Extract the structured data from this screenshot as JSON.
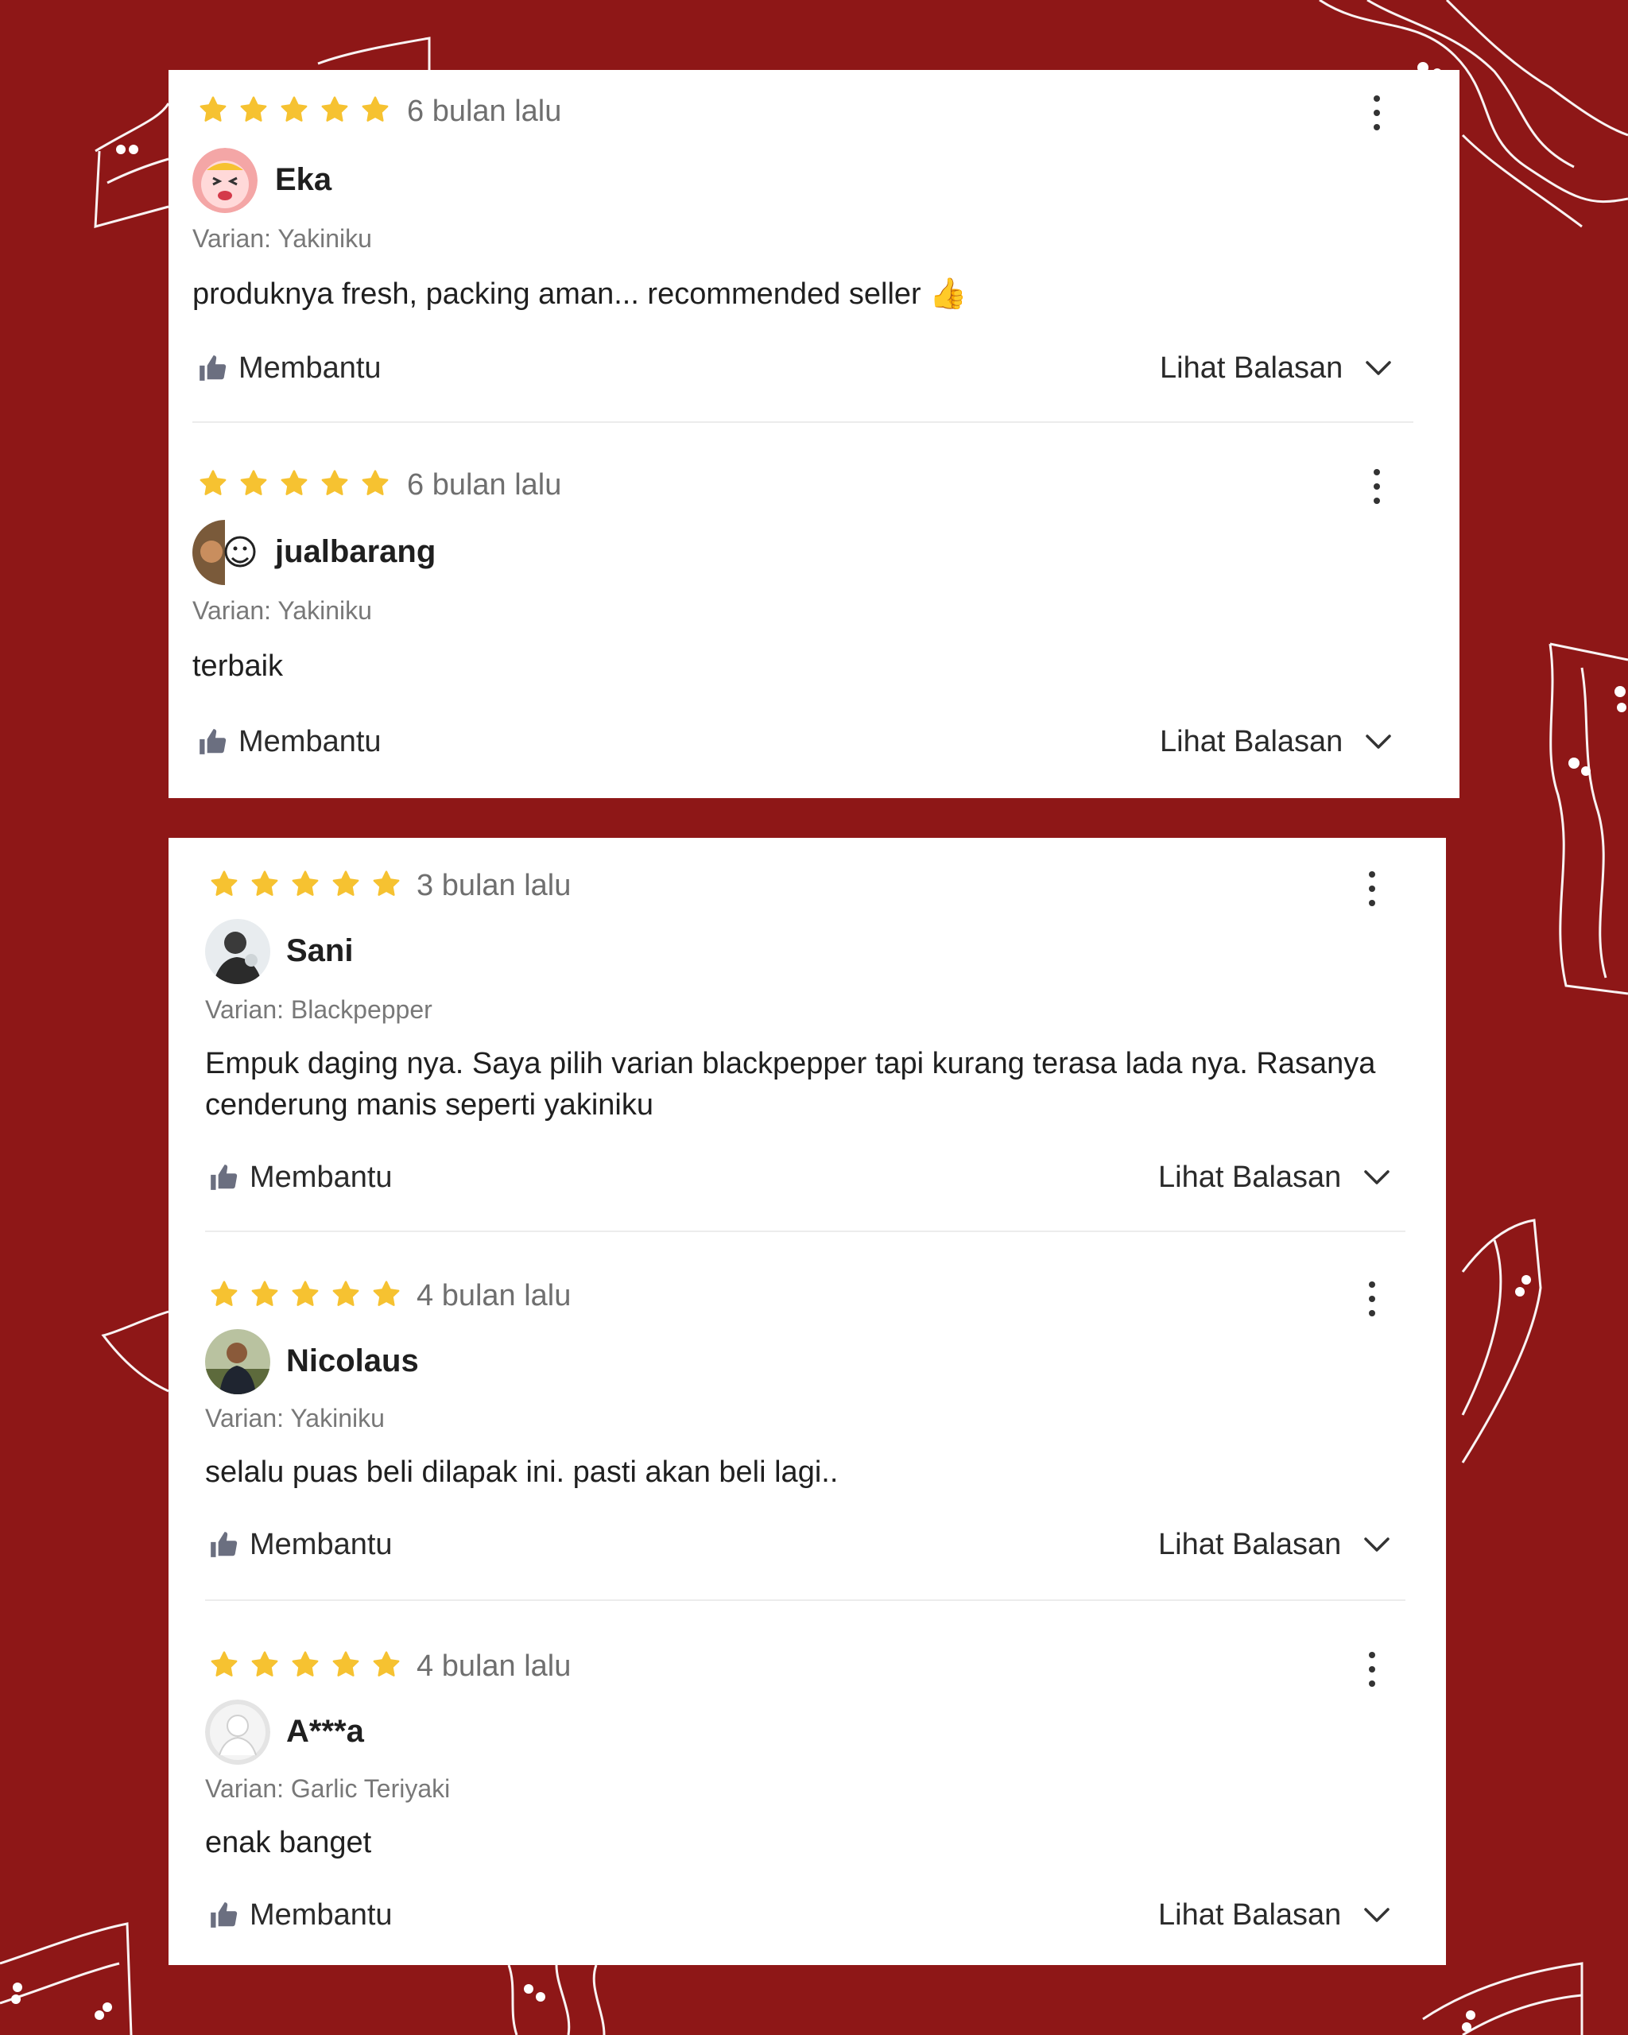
{
  "theme": {
    "background": "#8e1717",
    "star_color": "#f6c231",
    "card_background": "#ffffff"
  },
  "labels": {
    "helpful": "Membantu",
    "view_replies": "Lihat Balasan",
    "variant_prefix": "Varian:"
  },
  "reviews": [
    {
      "rating": 5,
      "time": "6 bulan lalu",
      "name": "Eka",
      "avatar": "cartoon-face-avatar",
      "variant": "Varian: Yakiniku",
      "text": "produknya fresh, packing aman... recommended seller 👍"
    },
    {
      "rating": 5,
      "time": "6 bulan lalu",
      "name": "jualbarang",
      "avatar": "meme-face-avatar",
      "variant": "Varian: Yakiniku",
      "text": "terbaik"
    },
    {
      "rating": 5,
      "time": "3 bulan lalu",
      "name": "Sani",
      "avatar": "photo-avatar",
      "variant": "Varian: Blackpepper",
      "text": "Empuk daging nya. Saya pilih varian blackpepper tapi kurang terasa lada nya. Rasanya cenderung manis seperti yakiniku"
    },
    {
      "rating": 5,
      "time": "4 bulan lalu",
      "name": "Nicolaus",
      "avatar": "photo-avatar",
      "variant": "Varian: Yakiniku",
      "text": "selalu puas beli dilapak ini. pasti akan beli lagi.."
    },
    {
      "rating": 5,
      "time": "4 bulan lalu",
      "name": "A***a",
      "avatar": "default-user-avatar",
      "variant": "Varian: Garlic Teriyaki",
      "text": "enak banget"
    }
  ]
}
